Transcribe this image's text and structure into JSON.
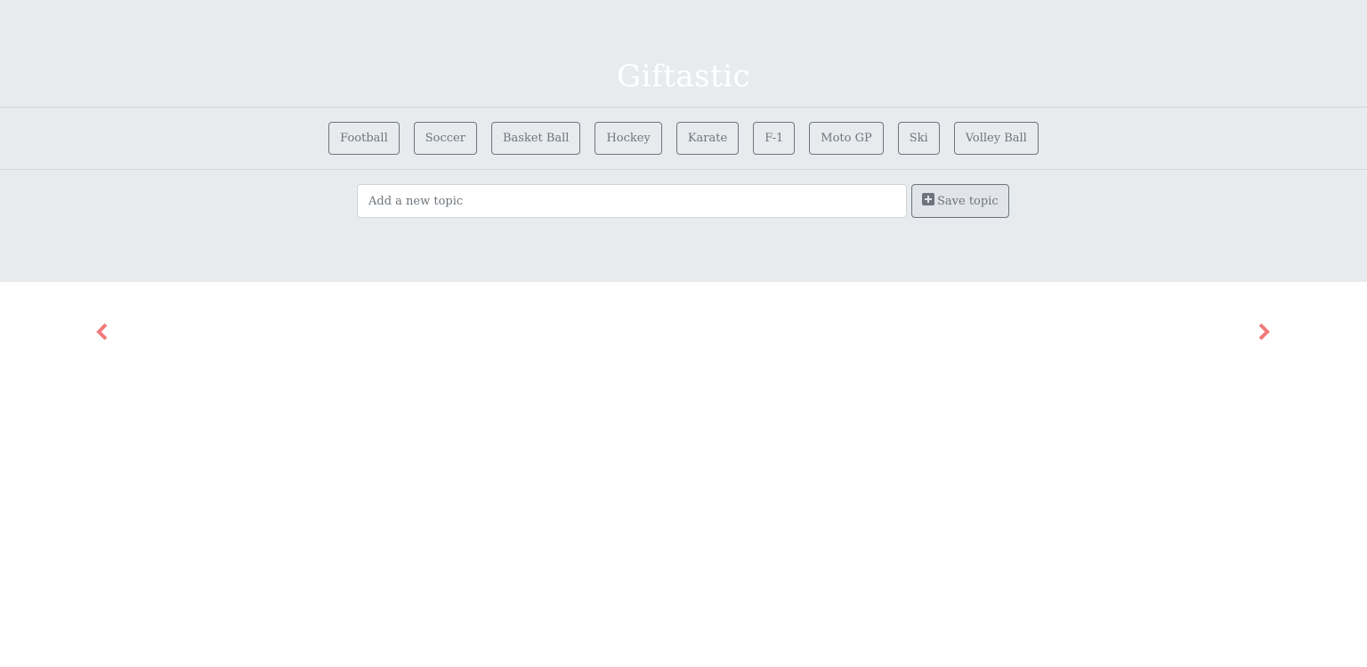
{
  "header": {
    "title": "Giftastic"
  },
  "topics": [
    {
      "label": "Football"
    },
    {
      "label": "Soccer"
    },
    {
      "label": "Basket Ball"
    },
    {
      "label": "Hockey"
    },
    {
      "label": "Karate"
    },
    {
      "label": "F-1"
    },
    {
      "label": "Moto GP"
    },
    {
      "label": "Ski"
    },
    {
      "label": "Volley Ball"
    }
  ],
  "form": {
    "input_placeholder": "Add a new topic",
    "input_value": "",
    "save_label": "Save topic",
    "save_icon": "plus-square-icon"
  },
  "carousel": {
    "prev_icon": "chevron-left-icon",
    "next_icon": "chevron-right-icon",
    "control_color": "#f17a7a"
  },
  "colors": {
    "header_bg": "#e8ebee",
    "title_color": "#ffffff",
    "button_outline": "#6c757d"
  }
}
